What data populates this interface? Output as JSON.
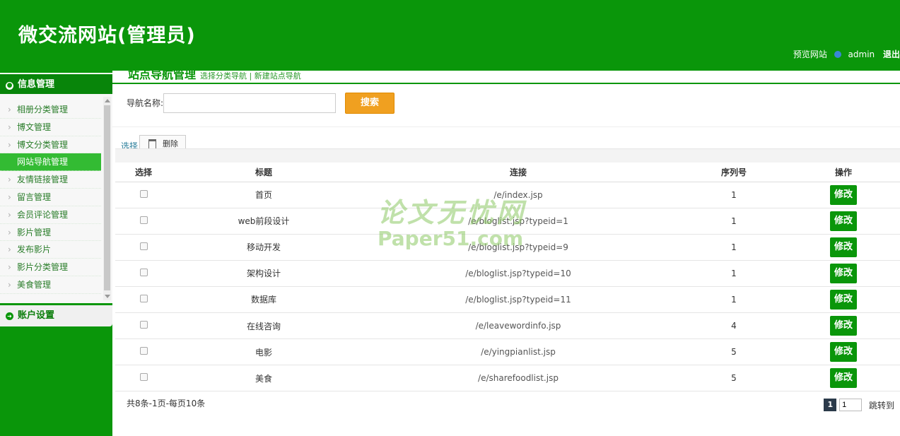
{
  "header": {
    "title": "微交流网站(管理员)",
    "preview_link": "预览网站",
    "username": "admin",
    "logout": "退出"
  },
  "sidebar": {
    "section1": "信息管理",
    "items": [
      {
        "label": "相册分类管理",
        "active": false
      },
      {
        "label": "博文管理",
        "active": false
      },
      {
        "label": "博文分类管理",
        "active": false
      },
      {
        "label": "网站导航管理",
        "active": true
      },
      {
        "label": "友情链接管理",
        "active": false
      },
      {
        "label": "留言管理",
        "active": false
      },
      {
        "label": "会员评论管理",
        "active": false
      },
      {
        "label": "影片管理",
        "active": false
      },
      {
        "label": "发布影片",
        "active": false
      },
      {
        "label": "影片分类管理",
        "active": false
      },
      {
        "label": "美食管理",
        "active": false
      }
    ],
    "section2": "账户设置"
  },
  "main": {
    "page_title": "站点导航管理",
    "page_subtitle": "选择分类导航 | 新建站点导航",
    "search": {
      "label": "导航名称:",
      "value": "",
      "button": "搜索"
    },
    "toolbar": {
      "select": "选择",
      "delete": "删除"
    },
    "table": {
      "headers": [
        "选择",
        "标题",
        "连接",
        "序列号",
        "操作"
      ],
      "rows": [
        {
          "title": "首页",
          "link": "/e/index.jsp",
          "order": "1",
          "action": "修改"
        },
        {
          "title": "web前段设计",
          "link": "/e/bloglist.jsp?typeid=1",
          "order": "1",
          "action": "修改"
        },
        {
          "title": "移动开发",
          "link": "/e/bloglist.jsp?typeid=9",
          "order": "1",
          "action": "修改"
        },
        {
          "title": "架构设计",
          "link": "/e/bloglist.jsp?typeid=10",
          "order": "1",
          "action": "修改"
        },
        {
          "title": "数据库",
          "link": "/e/bloglist.jsp?typeid=11",
          "order": "1",
          "action": "修改"
        },
        {
          "title": "在线咨询",
          "link": "/e/leavewordinfo.jsp",
          "order": "4",
          "action": "修改"
        },
        {
          "title": "电影",
          "link": "/e/yingpianlist.jsp",
          "order": "5",
          "action": "修改"
        },
        {
          "title": "美食",
          "link": "/e/sharefoodlist.jsp",
          "order": "5",
          "action": "修改"
        }
      ]
    },
    "footer": {
      "summary": "共8条-1页-每页10条",
      "current_page": "1",
      "page_input": "1",
      "jump": "跳转到"
    }
  },
  "watermark": {
    "line1": "论文无忧网",
    "line2": "Paper51.com"
  },
  "colors": {
    "brand_green": "#0a960a",
    "search_button": "#f0a020",
    "active_item": "#33bb33"
  }
}
